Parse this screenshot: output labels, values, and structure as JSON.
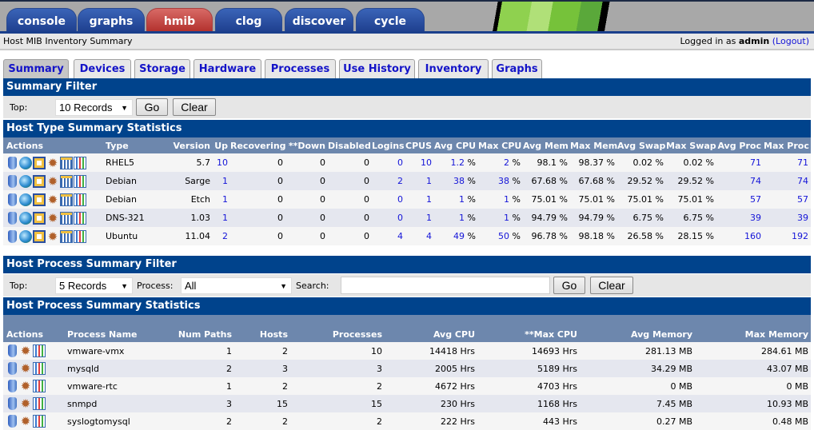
{
  "top_tabs": [
    {
      "label": "console"
    },
    {
      "label": "graphs"
    },
    {
      "label": "hmib",
      "active": true
    },
    {
      "label": "clog"
    },
    {
      "label": "discover"
    },
    {
      "label": "cycle"
    }
  ],
  "breadcrumb": "Host MIB Inventory Summary",
  "login": {
    "prefix": "Logged in as",
    "user": "admin",
    "logout": "(Logout)"
  },
  "sub_tabs": [
    {
      "label": "Summary",
      "active": true
    },
    {
      "label": "Devices"
    },
    {
      "label": "Storage"
    },
    {
      "label": "Hardware"
    },
    {
      "label": "Processes"
    },
    {
      "label": "Use History"
    },
    {
      "label": "Inventory"
    },
    {
      "label": "Graphs"
    }
  ],
  "summary_filter": {
    "title": "Summary Filter",
    "top_label": "Top:",
    "top_value": "10 Records",
    "go": "Go",
    "clear": "Clear"
  },
  "host_type": {
    "title": "Host Type Summary Statistics",
    "columns": [
      "Actions",
      "Type",
      "Version",
      "Up",
      "Recovering",
      "**Down",
      "Disabled",
      "Logins",
      "CPUS",
      "Avg CPU",
      "Max CPU",
      "Avg Mem",
      "Max Mem",
      "Avg Swap",
      "Max Swap",
      "Avg Proc",
      "Max Proc"
    ],
    "rows": [
      [
        "RHEL5",
        "5.7",
        "10",
        "0",
        "0",
        "0",
        "0",
        "10",
        "1.2",
        "2",
        "98.1 %",
        "98.37 %",
        "0.02 %",
        "0.02 %",
        "71",
        "71"
      ],
      [
        "Debian",
        "Sarge",
        "1",
        "0",
        "0",
        "0",
        "2",
        "1",
        "38",
        "38",
        "67.68 %",
        "67.68 %",
        "29.52 %",
        "29.52 %",
        "74",
        "74"
      ],
      [
        "Debian",
        "Etch",
        "1",
        "0",
        "0",
        "0",
        "0",
        "1",
        "1",
        "1",
        "75.01 %",
        "75.01 %",
        "75.01 %",
        "75.01 %",
        "57",
        "57"
      ],
      [
        "DNS-321",
        "1.03",
        "1",
        "0",
        "0",
        "0",
        "0",
        "1",
        "1",
        "1",
        "94.79 %",
        "94.79 %",
        "6.75 %",
        "6.75 %",
        "39",
        "39"
      ],
      [
        "Ubuntu",
        "11.04",
        "2",
        "0",
        "0",
        "0",
        "4",
        "4",
        "49",
        "50",
        "96.78 %",
        "98.18 %",
        "26.58 %",
        "28.15 %",
        "160",
        "192"
      ]
    ],
    "pct_suffix": " %",
    "row_icons": [
      "server-icon",
      "globe-icon",
      "monitor-icon",
      "gear-icon",
      "calendar-icon",
      "chart-icon"
    ]
  },
  "process_filter": {
    "title": "Host Process Summary Filter",
    "top_label": "Top:",
    "top_value": "5 Records",
    "process_label": "Process:",
    "process_value": "All",
    "search_label": "Search:",
    "search_value": "",
    "go": "Go",
    "clear": "Clear"
  },
  "process": {
    "title": "Host Process Summary Statistics",
    "columns": [
      "Actions",
      "Process Name",
      "Num Paths",
      "Hosts",
      "Processes",
      "Avg CPU",
      "**Max CPU",
      "Avg Memory",
      "Max Memory"
    ],
    "rows": [
      [
        "vmware-vmx",
        "1",
        "2",
        "10",
        "14418 Hrs",
        "14693 Hrs",
        "281.13 MB",
        "284.61 MB"
      ],
      [
        "mysqld",
        "2",
        "3",
        "3",
        "2005 Hrs",
        "5189 Hrs",
        "34.29 MB",
        "43.07 MB"
      ],
      [
        "vmware-rtc",
        "1",
        "2",
        "2",
        "4672 Hrs",
        "4703 Hrs",
        "0 MB",
        "0 MB"
      ],
      [
        "snmpd",
        "3",
        "15",
        "15",
        "230 Hrs",
        "1168 Hrs",
        "7.45 MB",
        "10.93 MB"
      ],
      [
        "syslogtomysql",
        "2",
        "2",
        "2",
        "222 Hrs",
        "443 Hrs",
        "0.27 MB",
        "0.48 MB"
      ]
    ],
    "row_icons": [
      "server-icon",
      "gear-icon",
      "chart-icon"
    ]
  }
}
